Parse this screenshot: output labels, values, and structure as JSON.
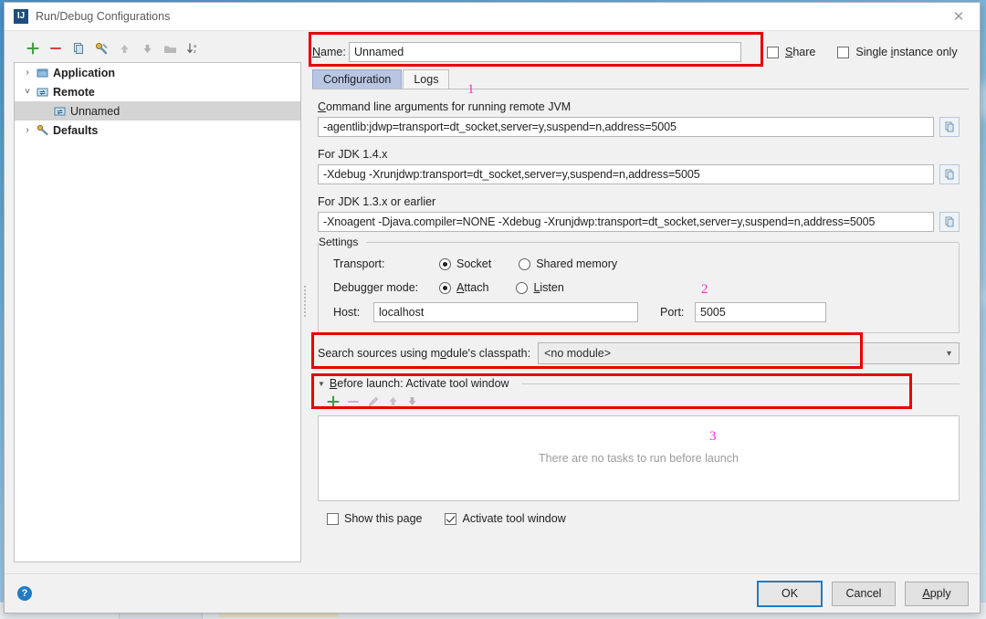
{
  "window": {
    "title": "Run/Debug Configurations",
    "app_icon": "intellij-idea-icon",
    "close_icon": "close-icon"
  },
  "tree_toolbar": {
    "buttons": [
      {
        "name": "add-configuration-button",
        "icon": "plus-icon",
        "glyph": "+"
      },
      {
        "name": "remove-configuration-button",
        "icon": "minus-icon",
        "glyph": "–"
      },
      {
        "name": "copy-configuration-button",
        "icon": "copy-icon",
        "glyph": "❐"
      },
      {
        "name": "save-configuration-button",
        "icon": "wrench-icon",
        "glyph": "⚒"
      },
      {
        "name": "move-up-button",
        "icon": "arrow-up-icon",
        "glyph": "↑"
      },
      {
        "name": "move-down-button",
        "icon": "arrow-down-icon",
        "glyph": "↓"
      },
      {
        "name": "new-folder-button",
        "icon": "folder-icon",
        "glyph": "▬"
      },
      {
        "name": "sort-alphabetically-button",
        "icon": "sort-az-icon",
        "glyph": "↓"
      }
    ]
  },
  "tree": {
    "nodes": [
      {
        "label": "Application",
        "arrow": "›",
        "expanded": false,
        "selected": false,
        "bold": true,
        "icon": "application-config-icon"
      },
      {
        "label": "Remote",
        "arrow": "˅",
        "expanded": true,
        "selected": false,
        "bold": true,
        "icon": "remote-config-icon"
      },
      {
        "label": "Unnamed",
        "arrow": "",
        "expanded": false,
        "selected": true,
        "bold": false,
        "icon": "remote-config-icon"
      },
      {
        "label": "Defaults",
        "arrow": "›",
        "expanded": false,
        "selected": false,
        "bold": true,
        "icon": "defaults-icon"
      }
    ]
  },
  "name_row": {
    "label": "Name:",
    "value": "Unnamed",
    "placeholder": "",
    "share_label": "Share",
    "share_checked": false,
    "single_instance_label": "Single instance only",
    "single_instance_checked": false
  },
  "tabs": [
    {
      "label": "Configuration",
      "active": true,
      "name": "tab-configuration"
    },
    {
      "label": "Logs",
      "active": false,
      "name": "tab-logs"
    }
  ],
  "config": {
    "cmdline_label": "Command line arguments for running remote JVM",
    "cmdline_value": "-agentlib:jdwp=transport=dt_socket,server=y,suspend=n,address=5005",
    "jdk14_label": "For JDK 1.4.x",
    "jdk14_value": "-Xdebug -Xrunjdwp:transport=dt_socket,server=y,suspend=n,address=5005",
    "jdk13_label": "For JDK 1.3.x or earlier",
    "jdk13_value": "-Xnoagent -Djava.compiler=NONE -Xdebug -Xrunjdwp:transport=dt_socket,server=y,suspend=n,address=5005",
    "copy_icon": "copy-to-clipboard-icon"
  },
  "settings": {
    "group_title": "Settings",
    "transport_label": "Transport:",
    "transport_options": [
      {
        "label": "Socket",
        "selected": true
      },
      {
        "label": "Shared memory",
        "selected": false
      }
    ],
    "debugger_mode_label": "Debugger mode:",
    "debugger_mode_options": [
      {
        "label": "Attach",
        "selected": true
      },
      {
        "label": "Listen",
        "selected": false
      }
    ],
    "host_label": "Host:",
    "host_value": "localhost",
    "port_label": "Port:",
    "port_value": "5005"
  },
  "module_row": {
    "label": "Search sources using module's classpath:",
    "value": "<no module>",
    "arrow_icon": "chevron-down-icon"
  },
  "before_launch": {
    "title": "Before launch: Activate tool window",
    "triangle_icon": "triangle-down-icon",
    "toolbar": [
      {
        "name": "add-task-button",
        "icon": "plus-icon",
        "glyph": "+",
        "enabled": true
      },
      {
        "name": "remove-task-button",
        "icon": "minus-icon",
        "glyph": "–",
        "enabled": false
      },
      {
        "name": "edit-task-button",
        "icon": "pencil-icon",
        "glyph": "✎",
        "enabled": false
      },
      {
        "name": "move-task-up-button",
        "icon": "arrow-up-icon",
        "glyph": "↑",
        "enabled": false
      },
      {
        "name": "move-task-down-button",
        "icon": "arrow-down-icon",
        "glyph": "↓",
        "enabled": false
      }
    ],
    "empty_text": "There are no tasks to run before launch",
    "show_page_label": "Show this page",
    "show_page_checked": false,
    "activate_tool_window_label": "Activate tool window",
    "activate_tool_window_checked": true
  },
  "footer": {
    "help_icon": "help-icon",
    "help_glyph": "?",
    "ok_label": "OK",
    "cancel_label": "Cancel",
    "apply_label": "Apply"
  },
  "annotations": [
    {
      "number": "1",
      "color": "#ff2bd0"
    },
    {
      "number": "2",
      "color": "#ff2bd0"
    },
    {
      "number": "3",
      "color": "#ff2bd0"
    }
  ],
  "colors": {
    "annotation_box": "#e60000",
    "annotation_text": "#ff2bd0",
    "active_tab": "#b8c6e4",
    "default_button_border": "#1f7cc4",
    "selection": "#d4d4d4"
  }
}
